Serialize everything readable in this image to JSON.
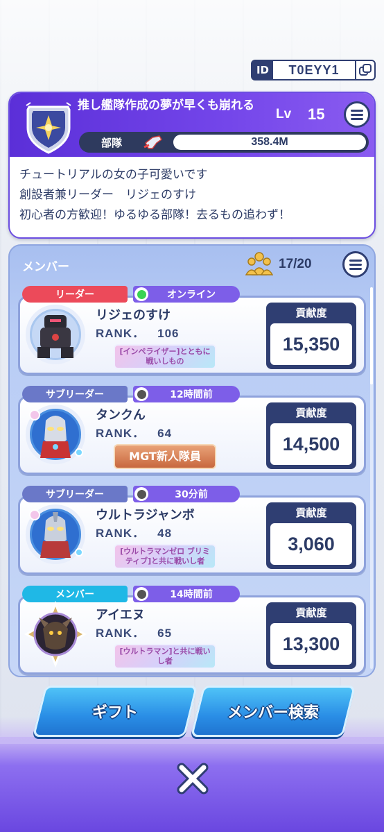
{
  "id_chip": {
    "label": "ID",
    "value": "T0EYY1"
  },
  "team": {
    "name": "推し艦隊作成の夢が早くも崩れる",
    "lv_label": "Lv",
    "lv_value": "15",
    "power_label": "部隊",
    "power_value": "358.4M",
    "description": [
      "チュートリアルの女の子可愛いです",
      "創設者兼リーダー　リジェのすけ",
      "初心者の方歓迎！ゆるゆる部隊！去るもの追わず！"
    ]
  },
  "members_panel": {
    "title": "メンバー",
    "count": "17/20",
    "contrib_label": "貢献度",
    "rank_label": "RANK．",
    "members": [
      {
        "role": "リーダー",
        "status": "オンライン",
        "status_color": "#39d353",
        "name": "リジェのすけ",
        "rank": "106",
        "title": "[インペライザー]とともに戦いしもの",
        "contribution": "15,350",
        "avatar": "dark-robot-icon"
      },
      {
        "role": "サブリーダー",
        "status": "12時間前",
        "status_color": "#555555",
        "name": "タンクん",
        "rank": "64",
        "title": "MGT新人隊員",
        "contribution": "14,500",
        "avatar": "ultraman-icon"
      },
      {
        "role": "サブリーダー",
        "status": "30分前",
        "status_color": "#555555",
        "name": "ウルトラジャンボ",
        "rank": "48",
        "title": "[ウルトラマンゼロ ブリミティブ]と共に戦いし者",
        "contribution": "3,060",
        "avatar": "ultraman-silver-icon"
      },
      {
        "role": "メンバー",
        "status": "14時間前",
        "status_color": "#555555",
        "name": "アイエヌ",
        "rank": "65",
        "title": "[ウルトラマン]と共に戦いし者",
        "contribution": "13,300",
        "avatar": "kaiju-icon"
      }
    ]
  },
  "buttons": {
    "gift": "ギフト",
    "member_search": "メンバー検索"
  },
  "colors": {
    "accent": "#6b4de0",
    "navy": "#2f3e72",
    "button_blue": "#2a8ee6"
  }
}
